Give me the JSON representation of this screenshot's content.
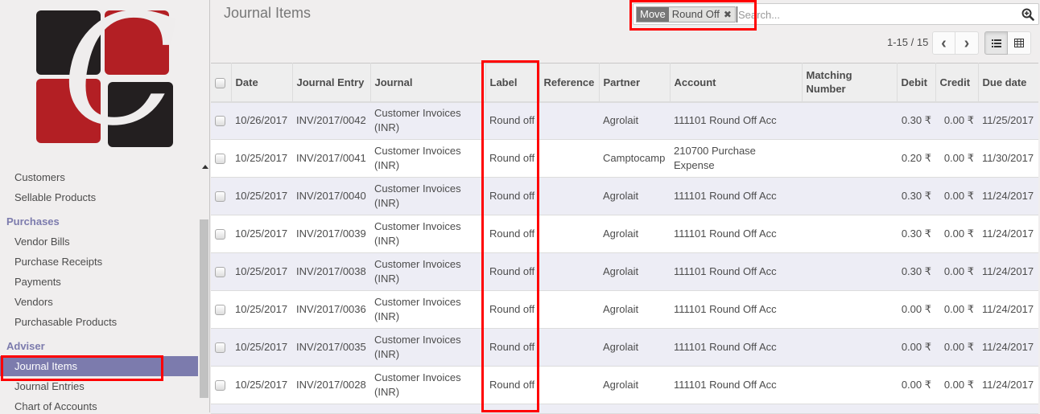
{
  "sidebar": {
    "logo_letter": "C",
    "items_before": [
      {
        "label": "Customers"
      },
      {
        "label": "Sellable Products"
      }
    ],
    "sections": [
      {
        "header": "Purchases",
        "items": [
          {
            "label": "Vendor Bills"
          },
          {
            "label": "Purchase Receipts"
          },
          {
            "label": "Payments"
          },
          {
            "label": "Vendors"
          },
          {
            "label": "Purchasable Products"
          }
        ]
      },
      {
        "header": "Adviser",
        "items": [
          {
            "label": "Journal Items",
            "active": true
          },
          {
            "label": "Journal Entries"
          },
          {
            "label": "Chart of Accounts"
          }
        ]
      }
    ]
  },
  "header": {
    "title": "Journal Items"
  },
  "search": {
    "facet_category": "Move",
    "facet_value": "Round Off",
    "facet_close": "✖",
    "placeholder": "Search...",
    "value": ""
  },
  "pager": {
    "value": "1-15 / 15",
    "prev": "‹",
    "next": "›"
  },
  "views": {
    "list": "list-view",
    "grid": "pivot-view",
    "active": "list"
  },
  "table": {
    "columns": [
      "Date",
      "Journal Entry",
      "Journal",
      "Label",
      "Reference",
      "Partner",
      "Account",
      "Matching Number",
      "Debit",
      "Credit",
      "Due date"
    ],
    "rows": [
      {
        "date": "10/26/2017",
        "entry": "INV/2017/0042",
        "journal": "Customer Invoices (INR)",
        "label": "Round off",
        "reference": "",
        "partner": "Agrolait",
        "account": "111101 Round Off Acc",
        "matching": "",
        "debit": "0.30 ₹",
        "credit": "0.00 ₹",
        "due": "11/25/2017"
      },
      {
        "date": "10/25/2017",
        "entry": "INV/2017/0041",
        "journal": "Customer Invoices (INR)",
        "label": "Round off",
        "reference": "",
        "partner": "Camptocamp",
        "account": "210700 Purchase Expense",
        "matching": "",
        "debit": "0.20 ₹",
        "credit": "0.00 ₹",
        "due": "11/30/2017"
      },
      {
        "date": "10/25/2017",
        "entry": "INV/2017/0040",
        "journal": "Customer Invoices (INR)",
        "label": "Round off",
        "reference": "",
        "partner": "Agrolait",
        "account": "111101 Round Off Acc",
        "matching": "",
        "debit": "0.30 ₹",
        "credit": "0.00 ₹",
        "due": "11/24/2017"
      },
      {
        "date": "10/25/2017",
        "entry": "INV/2017/0039",
        "journal": "Customer Invoices (INR)",
        "label": "Round off",
        "reference": "",
        "partner": "Agrolait",
        "account": "111101 Round Off Acc",
        "matching": "",
        "debit": "0.30 ₹",
        "credit": "0.00 ₹",
        "due": "11/24/2017"
      },
      {
        "date": "10/25/2017",
        "entry": "INV/2017/0038",
        "journal": "Customer Invoices (INR)",
        "label": "Round off",
        "reference": "",
        "partner": "Agrolait",
        "account": "111101 Round Off Acc",
        "matching": "",
        "debit": "0.30 ₹",
        "credit": "0.00 ₹",
        "due": "11/24/2017"
      },
      {
        "date": "10/25/2017",
        "entry": "INV/2017/0036",
        "journal": "Customer Invoices (INR)",
        "label": "Round off",
        "reference": "",
        "partner": "Agrolait",
        "account": "111101 Round Off Acc",
        "matching": "",
        "debit": "0.00 ₹",
        "credit": "0.00 ₹",
        "due": "11/24/2017"
      },
      {
        "date": "10/25/2017",
        "entry": "INV/2017/0035",
        "journal": "Customer Invoices (INR)",
        "label": "Round off",
        "reference": "",
        "partner": "Agrolait",
        "account": "111101 Round Off Acc",
        "matching": "",
        "debit": "0.00 ₹",
        "credit": "0.00 ₹",
        "due": "11/24/2017"
      },
      {
        "date": "10/25/2017",
        "entry": "INV/2017/0028",
        "journal": "Customer Invoices (INR)",
        "label": "Round off",
        "reference": "",
        "partner": "Agrolait",
        "account": "111101 Round Off Acc",
        "matching": "",
        "debit": "0.00 ₹",
        "credit": "0.00 ₹",
        "due": "11/24/2017"
      }
    ]
  },
  "colors": {
    "accent": "#7c7bad",
    "highlight": "#ff0000",
    "logo_red": "#b31f24",
    "logo_black": "#231f20"
  }
}
